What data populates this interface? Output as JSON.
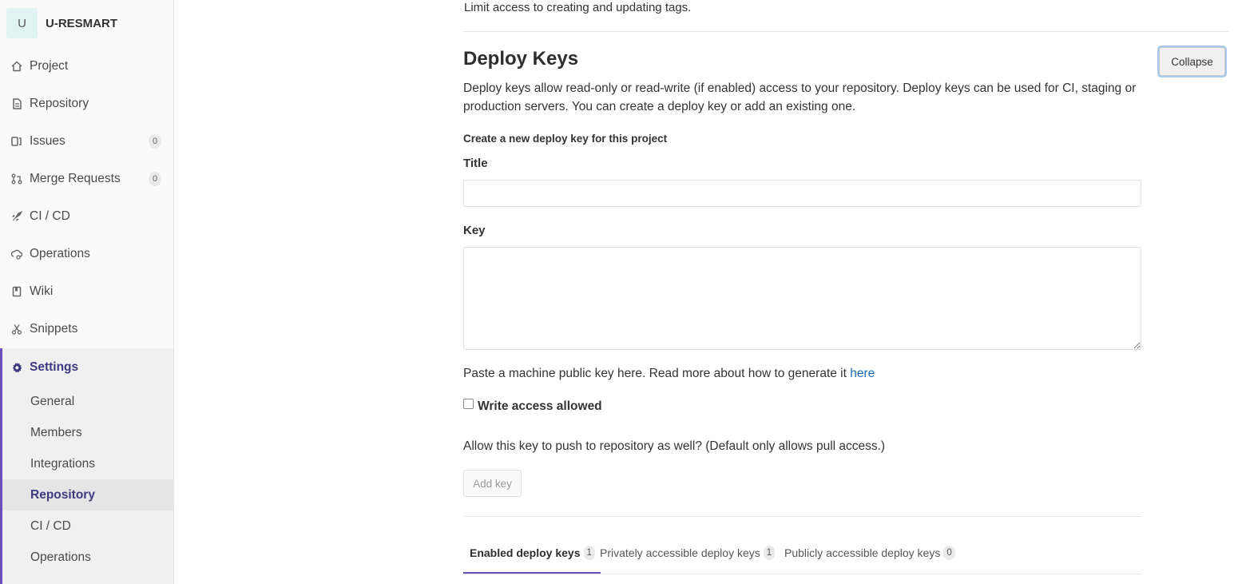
{
  "sidebar": {
    "project": {
      "avatar_letter": "U",
      "name": "U-RESMART"
    },
    "items": [
      {
        "label": "Project",
        "icon": "home-icon"
      },
      {
        "label": "Repository",
        "icon": "document-icon"
      },
      {
        "label": "Issues",
        "icon": "issues-icon",
        "badge": "0"
      },
      {
        "label": "Merge Requests",
        "icon": "merge-request-icon",
        "badge": "0"
      },
      {
        "label": "CI / CD",
        "icon": "rocket-icon"
      },
      {
        "label": "Operations",
        "icon": "cloud-gear-icon"
      },
      {
        "label": "Wiki",
        "icon": "book-icon"
      },
      {
        "label": "Snippets",
        "icon": "scissors-icon"
      }
    ],
    "settings": {
      "label": "Settings",
      "icon": "gear-icon",
      "sub_items": [
        {
          "label": "General"
        },
        {
          "label": "Members"
        },
        {
          "label": "Integrations"
        },
        {
          "label": "Repository",
          "active": true
        },
        {
          "label": "CI / CD"
        },
        {
          "label": "Operations"
        }
      ]
    }
  },
  "main": {
    "prev_section_text": "Limit access to creating and updating tags.",
    "deploy_keys": {
      "title": "Deploy Keys",
      "collapse_label": "Collapse",
      "description": "Deploy keys allow read-only or read-write (if enabled) access to your repository. Deploy keys can be used for CI, staging or production servers. You can create a deploy key or add an existing one.",
      "subheading": "Create a new deploy key for this project",
      "title_label": "Title",
      "title_value": "",
      "key_label": "Key",
      "key_value": "",
      "help_text": "Paste a machine public key here. Read more about how to generate it ",
      "help_link": "here",
      "write_access_label": "Write access allowed",
      "write_access_checked": false,
      "write_access_help": "Allow this key to push to repository as well? (Default only allows pull access.)",
      "add_key_label": "Add key",
      "tabs": [
        {
          "label": "Enabled deploy keys",
          "count": "1",
          "active": true
        },
        {
          "label": "Privately accessible deploy keys",
          "count": "1"
        },
        {
          "label": "Publicly accessible deploy keys",
          "count": "0"
        }
      ]
    }
  },
  "colors": {
    "accent": "#6b4fbb",
    "active_text": "#3d3a80",
    "link": "#1b69b6"
  }
}
